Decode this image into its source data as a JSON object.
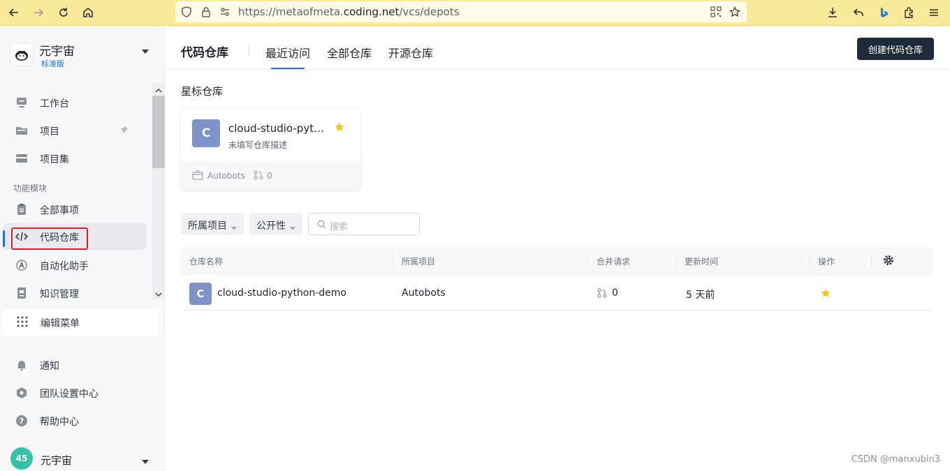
{
  "browser": {
    "url_prefix": "https://metaofmeta.",
    "url_domain": "coding.net",
    "url_path": "/vcs/depots"
  },
  "sidebar": {
    "brand_name": "元宇宙",
    "brand_tag": "标准版",
    "items_top": [
      {
        "label": "工作台",
        "icon": "workbench-icon"
      },
      {
        "label": "项目",
        "icon": "folder-icon"
      },
      {
        "label": "项目集",
        "icon": "project-set-icon"
      }
    ],
    "section_label": "功能模块",
    "items_module": [
      {
        "label": "全部事项",
        "icon": "clipboard-icon"
      },
      {
        "label": "代码仓库",
        "icon": "code-icon"
      },
      {
        "label": "自动化助手",
        "icon": "automation-icon"
      },
      {
        "label": "知识管理",
        "icon": "knowledge-icon"
      }
    ],
    "edit_menu": "编辑菜单",
    "items_bottom": [
      {
        "label": "通知",
        "icon": "bell-icon"
      },
      {
        "label": "团队设置中心",
        "icon": "settings-icon"
      },
      {
        "label": "帮助中心",
        "icon": "help-icon"
      }
    ],
    "footer": {
      "avatar_text": "45",
      "name": "元宇宙"
    }
  },
  "header": {
    "title": "代码仓库",
    "tabs": [
      "最近访问",
      "全部仓库",
      "开源仓库"
    ],
    "active_tab": "最近访问",
    "create_button": "创建代码仓库"
  },
  "starred": {
    "title": "星标仓库",
    "card": {
      "avatar": "C",
      "name": "cloud-studio-pyth...",
      "description": "未填写仓库描述",
      "project": "Autobots",
      "merge_requests": "0"
    }
  },
  "filters": {
    "project": "所属项目",
    "visibility": "公开性",
    "search_placeholder": "搜索"
  },
  "table": {
    "columns": [
      "仓库名称",
      "所属项目",
      "合并请求",
      "更新时间",
      "操作"
    ],
    "rows": [
      {
        "avatar": "C",
        "name": "cloud-studio-python-demo",
        "project": "Autobots",
        "merge_requests": "0",
        "updated": "5 天前"
      }
    ]
  },
  "watermark": "CSDN @manxubin3",
  "colors": {
    "accent": "#2a6ce6",
    "star": "#f5c518",
    "avatar": "#7e93c9",
    "button_dark": "#1f2a3a",
    "highlight": "#e02020"
  }
}
